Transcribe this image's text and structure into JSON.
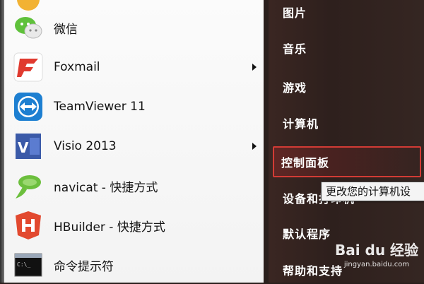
{
  "left_menu": {
    "items": [
      {
        "label": "微信",
        "icon": "wechat-icon",
        "submenu": false
      },
      {
        "label": "Foxmail",
        "icon": "foxmail-icon",
        "submenu": true
      },
      {
        "label": "TeamViewer 11",
        "icon": "teamviewer-icon",
        "submenu": false
      },
      {
        "label": "Visio 2013",
        "icon": "visio-icon",
        "submenu": true
      },
      {
        "label": "navicat - 快捷方式",
        "icon": "navicat-icon",
        "submenu": false
      },
      {
        "label": "HBuilder - 快捷方式",
        "icon": "hbuilder-icon",
        "submenu": false
      },
      {
        "label": "命令提示符",
        "icon": "command-prompt-icon",
        "submenu": false
      }
    ]
  },
  "right_menu": {
    "items": [
      {
        "label": "图片"
      },
      {
        "label": "音乐"
      },
      {
        "label": "游戏"
      },
      {
        "label": "计算机"
      },
      {
        "label": "控制面板",
        "highlighted": true
      },
      {
        "label": "设备和打印机"
      },
      {
        "label": "默认程序"
      },
      {
        "label": "帮助和支持"
      }
    ]
  },
  "tooltip": {
    "text": "更改您的计算机设"
  },
  "watermark": {
    "brand": "Bai du 经验",
    "site": "jingyan.baidu.com"
  },
  "colors": {
    "highlight_border": "#d23b35",
    "right_panel": "#2e201d",
    "left_panel": "#f7f7f7"
  }
}
